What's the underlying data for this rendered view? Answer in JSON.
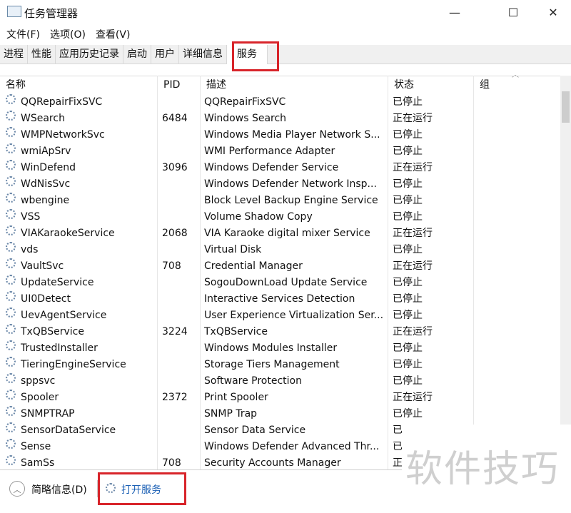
{
  "window": {
    "title": "任务管理器",
    "minimize": "—",
    "maximize": "☐",
    "close": "✕"
  },
  "menu": [
    "文件(F)",
    "选项(O)",
    "查看(V)"
  ],
  "tabs": [
    "进程",
    "性能",
    "应用历史记录",
    "启动",
    "用户",
    "详细信息",
    "服务"
  ],
  "active_tab": "服务",
  "columns": {
    "name": "名称",
    "pid": "PID",
    "desc": "描述",
    "status": "状态",
    "group": "组"
  },
  "rows": [
    [
      "QQRepairFixSVC",
      "",
      "QQRepairFixSVC",
      "已停止"
    ],
    [
      "WSearch",
      "6484",
      "Windows Search",
      "正在运行"
    ],
    [
      "WMPNetworkSvc",
      "",
      "Windows Media Player Network S...",
      "已停止"
    ],
    [
      "wmiApSrv",
      "",
      "WMI Performance Adapter",
      "已停止"
    ],
    [
      "WinDefend",
      "3096",
      "Windows Defender Service",
      "正在运行"
    ],
    [
      "WdNisSvc",
      "",
      "Windows Defender Network Insp...",
      "已停止"
    ],
    [
      "wbengine",
      "",
      "Block Level Backup Engine Service",
      "已停止"
    ],
    [
      "VSS",
      "",
      "Volume Shadow Copy",
      "已停止"
    ],
    [
      "VIAKaraokeService",
      "2068",
      "VIA Karaoke digital mixer Service",
      "正在运行"
    ],
    [
      "vds",
      "",
      "Virtual Disk",
      "已停止"
    ],
    [
      "VaultSvc",
      "708",
      "Credential Manager",
      "正在运行"
    ],
    [
      "UpdateService",
      "",
      "SogouDownLoad Update Service",
      "已停止"
    ],
    [
      "UI0Detect",
      "",
      "Interactive Services Detection",
      "已停止"
    ],
    [
      "UevAgentService",
      "",
      "User Experience Virtualization Ser...",
      "已停止"
    ],
    [
      "TxQBService",
      "3224",
      "TxQBService",
      "正在运行"
    ],
    [
      "TrustedInstaller",
      "",
      "Windows Modules Installer",
      "已停止"
    ],
    [
      "TieringEngineService",
      "",
      "Storage Tiers Management",
      "已停止"
    ],
    [
      "sppsvc",
      "",
      "Software Protection",
      "已停止"
    ],
    [
      "Spooler",
      "2372",
      "Print Spooler",
      "正在运行"
    ],
    [
      "SNMPTRAP",
      "",
      "SNMP Trap",
      "已停止"
    ],
    [
      "SensorDataService",
      "",
      "Sensor Data Service",
      "已"
    ],
    [
      "Sense",
      "",
      "Windows Defender Advanced Thr...",
      "已"
    ],
    [
      "SamSs",
      "708",
      "Security Accounts Manager",
      "正"
    ]
  ],
  "footer": {
    "fewer_details": "简略信息(D)",
    "open_services": "打开服务"
  },
  "watermark": "软件技巧"
}
